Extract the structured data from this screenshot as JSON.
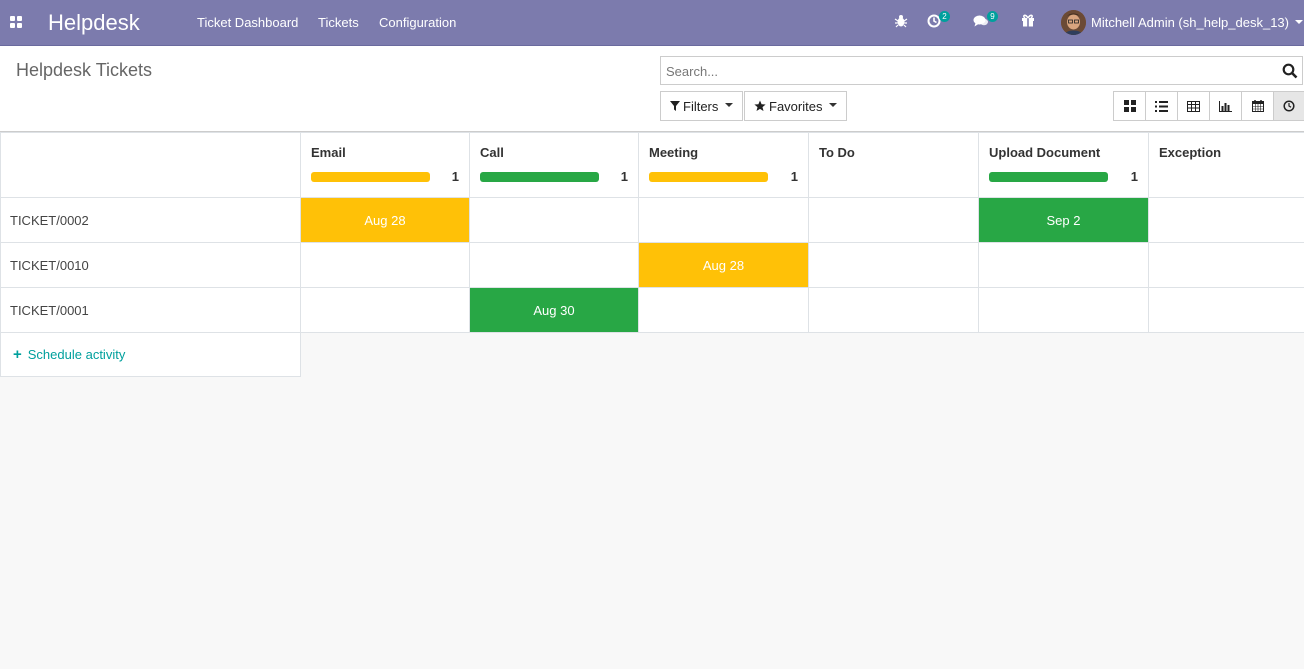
{
  "navbar": {
    "brand": "Helpdesk",
    "menu": [
      "Ticket Dashboard",
      "Tickets",
      "Configuration"
    ],
    "activity_count": "2",
    "message_count": "9",
    "user_name": "Mitchell Admin (sh_help_desk_13)"
  },
  "control_panel": {
    "title": "Helpdesk Tickets",
    "search_placeholder": "Search...",
    "filters_label": "Filters",
    "favorites_label": "Favorites",
    "views": [
      "kanban-icon",
      "list-icon",
      "pivot-icon",
      "graph-icon",
      "calendar-icon",
      "activity-icon"
    ]
  },
  "activity": {
    "columns": [
      {
        "name": "Email",
        "count": "1",
        "bar_color": "#ffc107"
      },
      {
        "name": "Call",
        "count": "1",
        "bar_color": "#28a745"
      },
      {
        "name": "Meeting",
        "count": "1",
        "bar_color": "#ffc107"
      },
      {
        "name": "To Do",
        "count": "",
        "bar_color": ""
      },
      {
        "name": "Upload Document",
        "count": "1",
        "bar_color": "#28a745"
      },
      {
        "name": "Exception",
        "count": "",
        "bar_color": ""
      }
    ],
    "rows": [
      {
        "name": "TICKET/0002",
        "cells": [
          "Aug 28",
          "",
          "",
          "",
          "Sep 2",
          ""
        ]
      },
      {
        "name": "TICKET/0010",
        "cells": [
          "",
          "",
          "Aug 28",
          "",
          "",
          ""
        ]
      },
      {
        "name": "TICKET/0001",
        "cells": [
          "",
          "Aug 30",
          "",
          "",
          "",
          ""
        ]
      }
    ],
    "schedule_label": "Schedule activity"
  },
  "colors": {
    "navbar": "#7c7bad",
    "overdue": "#ffc107",
    "planned": "#28a745",
    "link": "#00a09d"
  }
}
